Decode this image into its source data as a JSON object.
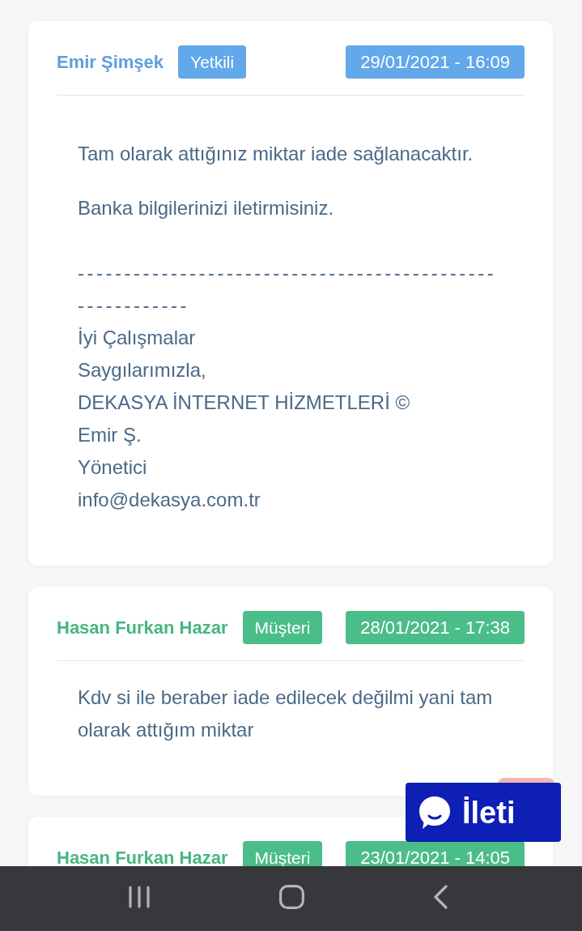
{
  "messages": [
    {
      "author": "Emir Şimşek",
      "role": "Yetkili",
      "kind": "staff",
      "date": "29/01/2021 - 16:09",
      "paragraphs": [
        "Tam olarak attığınız miktar iade sağlanacaktır.",
        "Banka bilgilerinizi iletirmisiniz."
      ],
      "separator": "---------------------------------------------------------",
      "signature": [
        "İyi Çalışmalar",
        "Saygılarımızla,",
        "DEKASYA İNTERNET HİZMETLERİ ©",
        "Emir Ş.",
        "Yönetici",
        "info@dekasya.com.tr"
      ]
    },
    {
      "author": "Hasan Furkan Hazar",
      "role": "Müşteri",
      "kind": "customer",
      "date": "28/01/2021 - 17:38",
      "text": "Kdv si ile beraber iade edilecek değilmi yani tam olarak attığım miktar"
    },
    {
      "author": "Hasan Furkan Hazar",
      "role": "Müşteri",
      "kind": "customer",
      "date": "23/01/2021 - 14:05"
    }
  ],
  "chat_button": {
    "label": "İleti"
  }
}
